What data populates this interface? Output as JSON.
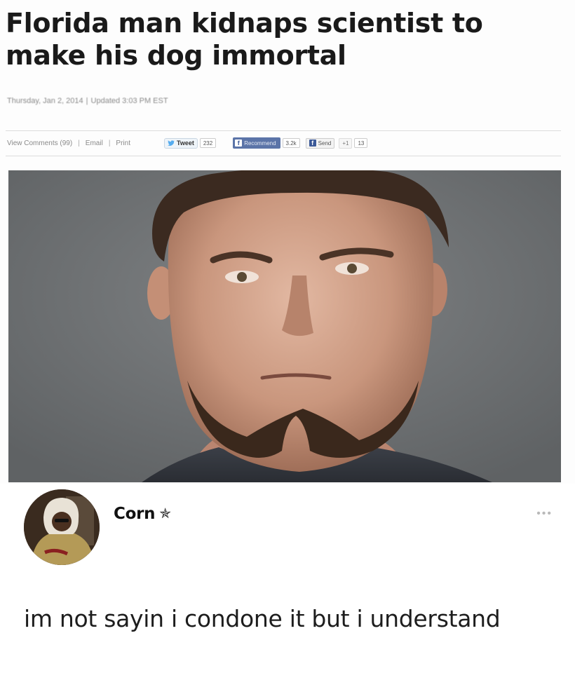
{
  "article": {
    "headline": "Florida man kidnaps scientist to make his dog immortal",
    "date": "Thursday, Jan 2, 2014",
    "updated": "Updated 3:03 PM EST",
    "toolbar": {
      "comments": "View Comments (99)",
      "email": "Email",
      "print": "Print",
      "tweet_label": "Tweet",
      "tweet_count": "232",
      "recommend_label": "Recommend",
      "recommend_count": "3.2k",
      "send_label": "Send",
      "gplus_label": "+1",
      "gplus_count": "13"
    },
    "photo_icon": "mugshot-photo"
  },
  "tweet": {
    "username": "Corn",
    "badge_icon": "star-icon",
    "more_icon": "more-icon",
    "text": "im not sayin i condone it but i understand"
  },
  "colors": {
    "facebook": "#5b74a8",
    "backdrop": "#6b6e70",
    "meta_text": "#8a8a8a"
  }
}
